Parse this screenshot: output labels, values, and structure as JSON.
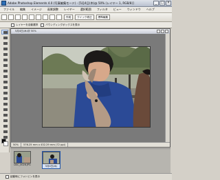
{
  "window": {
    "title": "Adobe Photoshop Elements 4.0 (写真編集モード) - [5月4日(木)@ 50% (レイヤー 1, RGB/8)]"
  },
  "menu": {
    "items": [
      "ファイル",
      "編集",
      "イメージ",
      "画質調整",
      "レイヤー",
      "選択範囲",
      "フィルタ",
      "ビュー",
      "ウィンドウ",
      "ヘルプ"
    ]
  },
  "toolbar": {
    "create_label": "作成",
    "quickfix_label": "クイック修正",
    "standard_label": "標準編集"
  },
  "options": {
    "auto_select_label": "レイヤーを自動選択",
    "show_bounding_label": "バウンディングボックスを表示"
  },
  "document": {
    "title": "5月4日(木)@ 50%"
  },
  "status": {
    "zoom": "50%",
    "size": "576.25 mm x 432.29 mm (72 ppi)"
  },
  "bin": {
    "thumbs": [
      {
        "caption": "DSC_0026.JPG"
      },
      {
        "caption": "5月4日(木)"
      }
    ]
  },
  "footer": {
    "option_label": "起動時にフォトビンを表示"
  }
}
